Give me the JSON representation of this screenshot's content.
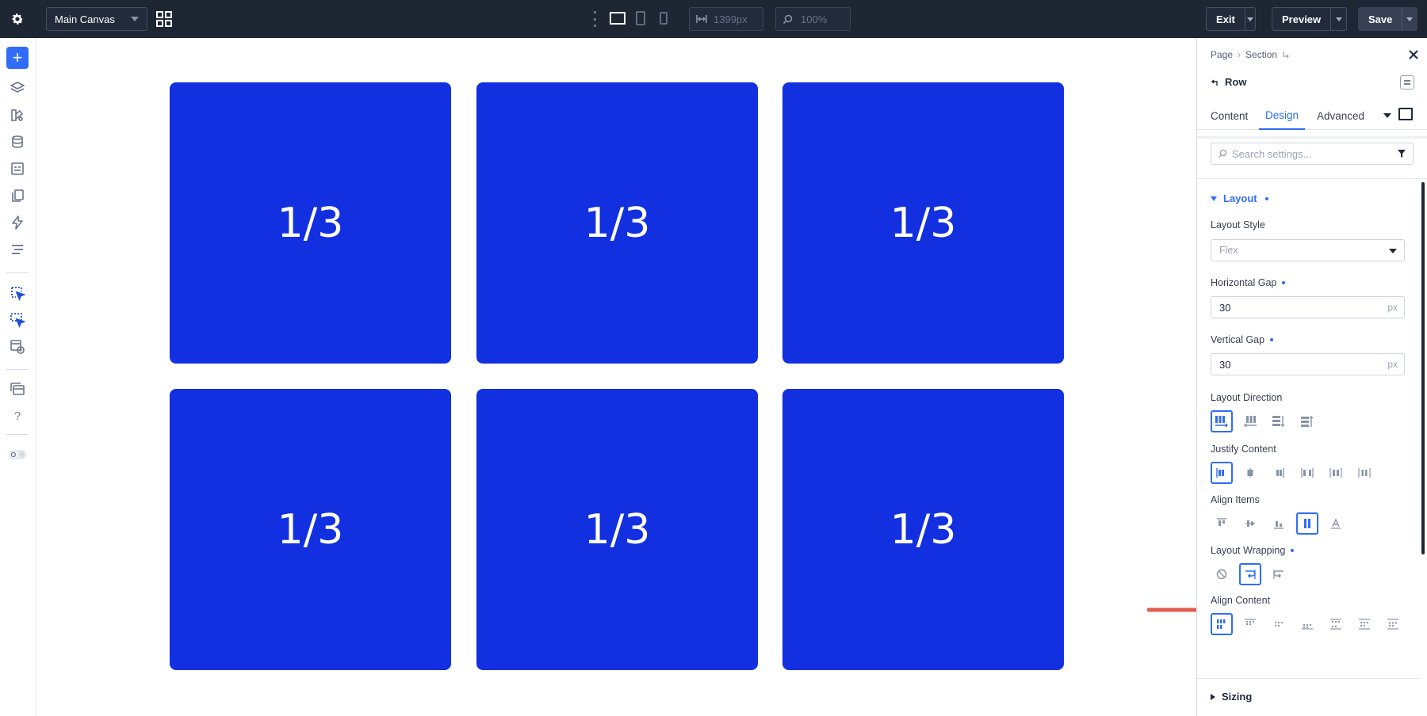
{
  "toolbar": {
    "canvas_name": "Main Canvas",
    "width_value": "1399px",
    "zoom_value": "100%",
    "exit_label": "Exit",
    "preview_label": "Preview",
    "save_label": "Save"
  },
  "canvas": {
    "columns": [
      "1/3",
      "1/3",
      "1/3",
      "1/3",
      "1/3",
      "1/3"
    ],
    "column_color": "#1230e0"
  },
  "panel": {
    "breadcrumb": [
      "Page",
      "Section"
    ],
    "element_title": "Row",
    "tabs": [
      "Content",
      "Design",
      "Advanced"
    ],
    "active_tab": "Design",
    "search_placeholder": "Search settings...",
    "layout_section": "Layout",
    "layout_style_label": "Layout Style",
    "layout_style_value": "Flex",
    "horizontal_gap_label": "Horizontal Gap",
    "horizontal_gap_value": "30",
    "vertical_gap_label": "Vertical Gap",
    "vertical_gap_value": "30",
    "unit": "px",
    "layout_direction_label": "Layout Direction",
    "justify_content_label": "Justify Content",
    "align_items_label": "Align Items",
    "layout_wrapping_label": "Layout Wrapping",
    "align_content_label": "Align Content",
    "sizing_section": "Sizing"
  },
  "colors": {
    "accent": "#2f6df6",
    "topbar": "#1e2533",
    "annotation_arrow": "#e25c4f"
  }
}
